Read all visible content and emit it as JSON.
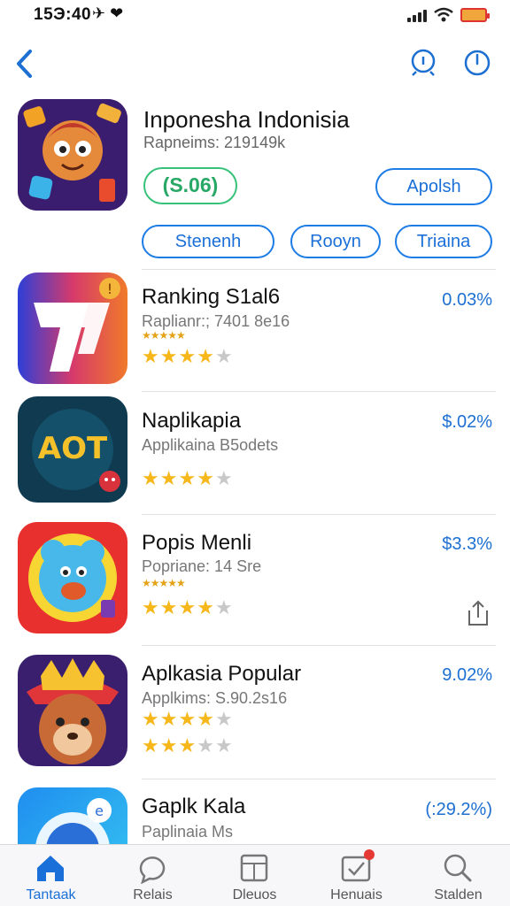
{
  "status": {
    "time": "15Э:40",
    "glyphs": "✈ ❤"
  },
  "hero": {
    "title": "Inponesha Indonisia",
    "subtitle": "Rapneims: 219149k",
    "price": "(S.06)",
    "action_label": "Apolsh",
    "pills": [
      "Stenenh",
      "Rooyn",
      "Triaina"
    ]
  },
  "apps": [
    {
      "title": "Ranking S1al6",
      "subtitle": "Raplianr:; 7401 8e16",
      "percent": "0.03%",
      "rating": 4,
      "mini_stars": "★★★★★"
    },
    {
      "title": "Naplikapia",
      "subtitle": "Applikaina B5odets",
      "percent": "$.02%",
      "rating": 4
    },
    {
      "title": "Popis Menli",
      "subtitle": "Popriane: 14 Sre",
      "percent": "$3.3%",
      "rating": 4,
      "mini_stars": "★★★★★"
    },
    {
      "title": "Aplkasia Popular",
      "subtitle": "Applkims: S.90.2s16",
      "percent": "9.02%",
      "rating": 4,
      "rating_second": 3
    },
    {
      "title": "Gaplk Kala",
      "subtitle": "Paplinaia Ms",
      "percent": "(:29.2%)"
    }
  ],
  "icon_text": {
    "app_2": "AOT"
  },
  "tabs": [
    {
      "label": "Tantaak",
      "icon": "home-icon",
      "active": true
    },
    {
      "label": "Relais",
      "icon": "chat-icon"
    },
    {
      "label": "Dleuos",
      "icon": "list-icon"
    },
    {
      "label": "Henuais",
      "icon": "check-icon",
      "badge": true
    },
    {
      "label": "Stalden",
      "icon": "search-icon"
    }
  ],
  "colors": {
    "accent": "#1a6fd8",
    "price_green": "#28a866",
    "star": "#f6b71a",
    "badge": "#e53935"
  }
}
